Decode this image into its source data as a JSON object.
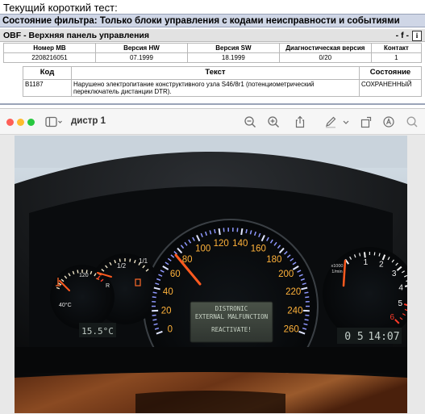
{
  "report": {
    "title": "Текущий короткий тест:",
    "filter_status": "Состояние фильтра: Только блоки управления с кодами неисправности и событиями",
    "module": {
      "name": "OBF - Верхняя панель управления",
      "flag": "- f -",
      "info_icon": "i"
    },
    "ecu_headers": [
      "Номер MB",
      "Версия HW",
      "Версия SW",
      "Диагностическая версия",
      "Контакт"
    ],
    "ecu_values": [
      "2208216051",
      "07.1999",
      "18.1999",
      "0/20",
      "1"
    ],
    "fault_headers": [
      "Код",
      "Текст",
      "Состояние"
    ],
    "faults": [
      {
        "code": "B1187",
        "text": "Нарушено электропитание конструктивного узла S46/8r1 (потенциометрический переключатель дистанции DTR).",
        "status": "СОХРАНЕННЫЙ"
      }
    ]
  },
  "viewer": {
    "title": "дистр 1",
    "traffic_lights": [
      "#fe5f57",
      "#febc2e",
      "#28c840"
    ],
    "icons": [
      "sidebar-icon",
      "chevron-down-icon",
      "zoom-out-icon",
      "zoom-in-icon",
      "share-icon",
      "markup-pen-icon",
      "chevron-down-icon",
      "rotate-icon",
      "markup-circle-icon",
      "search-icon"
    ]
  },
  "photo": {
    "speed_labels": [
      "0",
      "20",
      "40",
      "60",
      "80",
      "100",
      "120",
      "140",
      "160",
      "180",
      "200",
      "220",
      "240",
      "260"
    ],
    "rpm_labels": [
      "1",
      "2",
      "3",
      "4",
      "5",
      "6"
    ],
    "rpm_unit_top": "x1000",
    "rpm_unit_bottom": "1/min",
    "fuel_labels": [
      "1/2",
      "1/1",
      "R"
    ],
    "temp_labels": [
      "120",
      "40°C"
    ],
    "display_line1": "DISTRONIC",
    "display_line2": "EXTERNAL MALFUNCTION",
    "display_line3": "REACTIVATE!",
    "outside_temp": "15.5°C",
    "clock_day": "0 5",
    "clock_time": "14:07"
  }
}
